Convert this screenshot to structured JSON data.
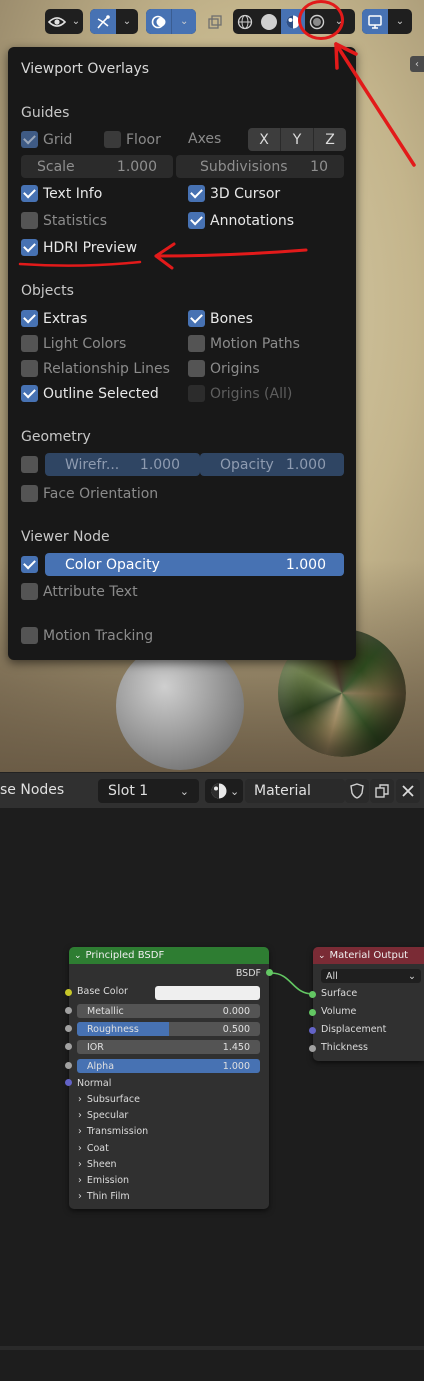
{
  "viewport_header": {
    "icons": [
      "visibility-icon",
      "gizmo-icon",
      "overlays-icon",
      "xray-icon",
      "wireframe-shading-icon",
      "solid-shading-icon",
      "material-preview-icon",
      "rendered-shading-icon",
      "editor-type-icon"
    ],
    "colors": {
      "active": "#4772b3",
      "annotation_red": "#e21a1a"
    }
  },
  "popover": {
    "title": "Viewport Overlays",
    "guides": {
      "heading": "Guides",
      "grid": {
        "label": "Grid",
        "checked": true
      },
      "floor": {
        "label": "Floor",
        "checked": false
      },
      "axes_label": "Axes",
      "axes": [
        "X",
        "Y",
        "Z"
      ],
      "scale": {
        "label": "Scale",
        "value": "1.000"
      },
      "subdivisions": {
        "label": "Subdivisions",
        "value": "10"
      },
      "text_info": {
        "label": "Text Info",
        "checked": true
      },
      "cursor_3d": {
        "label": "3D Cursor",
        "checked": true
      },
      "statistics": {
        "label": "Statistics",
        "checked": false
      },
      "annotations": {
        "label": "Annotations",
        "checked": true
      },
      "hdri_preview": {
        "label": "HDRI Preview",
        "checked": true
      }
    },
    "objects": {
      "heading": "Objects",
      "extras": {
        "label": "Extras",
        "checked": true
      },
      "bones": {
        "label": "Bones",
        "checked": true
      },
      "light_colors": {
        "label": "Light Colors",
        "checked": false
      },
      "motion_paths": {
        "label": "Motion Paths",
        "checked": false
      },
      "relationship_lines": {
        "label": "Relationship Lines",
        "checked": false
      },
      "origins": {
        "label": "Origins",
        "checked": false
      },
      "outline_selected": {
        "label": "Outline Selected",
        "checked": true
      },
      "origins_all": {
        "label": "Origins (All)",
        "checked": false
      }
    },
    "geometry": {
      "heading": "Geometry",
      "wireframe": {
        "label": "Wirefr...",
        "value": "1.000"
      },
      "opacity": {
        "label": "Opacity",
        "value": "1.000"
      },
      "face_orientation": {
        "label": "Face Orientation",
        "checked": false
      }
    },
    "viewer_node": {
      "heading": "Viewer Node",
      "color_opacity": {
        "label": "Color Opacity",
        "value": "1.000",
        "checked": true
      },
      "attribute_text": {
        "label": "Attribute Text",
        "checked": false
      }
    },
    "motion_tracking": {
      "label": "Motion Tracking",
      "checked": false
    }
  },
  "node_header": {
    "use_nodes_label": "se Nodes",
    "slot": "Slot 1",
    "material": "Material"
  },
  "nodes": {
    "principled": {
      "title": "Principled BSDF",
      "output": "BSDF",
      "base_color": "Base Color",
      "fields": [
        {
          "label": "Metallic",
          "value": "0.000",
          "fill": 0.0
        },
        {
          "label": "Roughness",
          "value": "0.500",
          "fill": 0.5
        },
        {
          "label": "IOR",
          "value": "1.450",
          "fill": 0.0
        },
        {
          "label": "Alpha",
          "value": "1.000",
          "fill": 1.0
        }
      ],
      "normal": "Normal",
      "panels": [
        "Subsurface",
        "Specular",
        "Transmission",
        "Coat",
        "Sheen",
        "Emission",
        "Thin Film"
      ],
      "header_color": "#2e7d32"
    },
    "material_output": {
      "title": "Material Output",
      "target": "All",
      "inputs": [
        "Surface",
        "Volume",
        "Displacement",
        "Thickness"
      ],
      "header_color": "#7a2b35"
    }
  }
}
